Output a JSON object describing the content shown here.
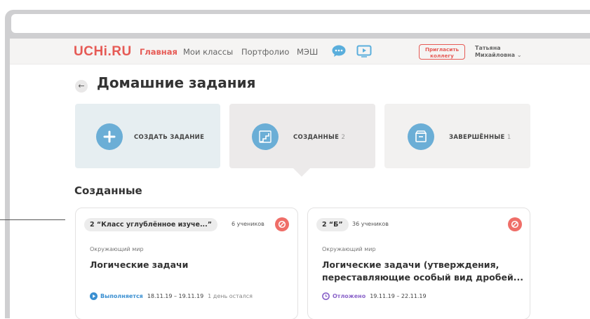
{
  "nav": {
    "logo": "UCHi.RU",
    "links": [
      "Главная",
      "Мои классы",
      "Портфолио",
      "МЭШ"
    ],
    "invite_line1": "Пригласить",
    "invite_line2": "коллегу",
    "user_line1": "Татьяна",
    "user_line2": "Михайловна",
    "user_chevron": "⌄"
  },
  "page": {
    "back_glyph": "←",
    "title": "Домашние задания",
    "section_title": "Созданные"
  },
  "tiles": [
    {
      "label": "СОЗДАТЬ ЗАДАНИЕ",
      "count": "",
      "icon": "plus-icon"
    },
    {
      "label": "СОЗДАННЫЕ",
      "count": "2",
      "icon": "stairs-icon"
    },
    {
      "label": "ЗАВЕРШЁННЫЕ",
      "count": "1",
      "icon": "archive-icon"
    }
  ],
  "cards": [
    {
      "class_name": "2 “Класс углублённое изуче...”",
      "students": "6 учеников",
      "subject": "Окружающий мир",
      "task": "Логические задачи",
      "status": "Выполняется",
      "dates": "18.11.19 – 19.11.19",
      "remaining": "1 день остался"
    },
    {
      "class_name": "2 “Б”",
      "students": "36 учеников",
      "subject": "Окружающий мир",
      "task_line1": "Логические задачи (утверждения,",
      "task_line2": "переставляющие особый вид дробей...",
      "status": "Отложено",
      "dates": "19.11.19 – 22.11.19"
    }
  ],
  "colors": {
    "brand": "#e65a55",
    "tile_blue": "#6baed6",
    "status_running": "#3a8fd1",
    "status_postponed": "#8a63c9"
  }
}
